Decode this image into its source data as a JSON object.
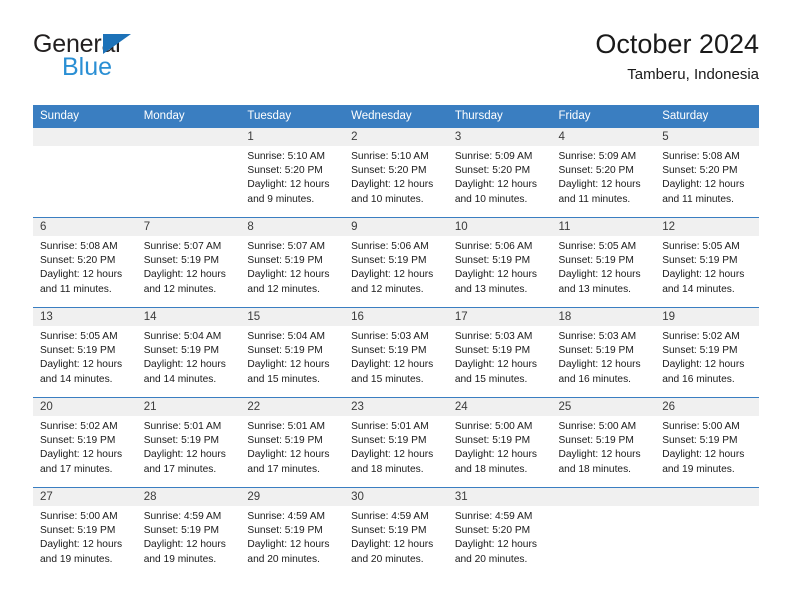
{
  "brand": {
    "name_part1": "General",
    "name_part2": "Blue",
    "triangle_color": "#1d72b8",
    "blue_text_color": "#2a8fd4"
  },
  "header": {
    "title": "October 2024",
    "location": "Tamberu, Indonesia"
  },
  "theme": {
    "header_blue": "#3a7ec1",
    "daynum_background": "#f0f0f0",
    "text_color": "#1a1a1a"
  },
  "weekdays": [
    "Sunday",
    "Monday",
    "Tuesday",
    "Wednesday",
    "Thursday",
    "Friday",
    "Saturday"
  ],
  "labels": {
    "sunrise_prefix": "Sunrise:",
    "sunset_prefix": "Sunset:",
    "daylight_prefix": "Daylight:"
  },
  "weeks": [
    [
      {
        "day": "",
        "sunrise": "",
        "sunset": "",
        "daylight_line1": "",
        "daylight_line2": ""
      },
      {
        "day": "",
        "sunrise": "",
        "sunset": "",
        "daylight_line1": "",
        "daylight_line2": ""
      },
      {
        "day": "1",
        "sunrise": "Sunrise: 5:10 AM",
        "sunset": "Sunset: 5:20 PM",
        "daylight_line1": "Daylight: 12 hours",
        "daylight_line2": "and 9 minutes."
      },
      {
        "day": "2",
        "sunrise": "Sunrise: 5:10 AM",
        "sunset": "Sunset: 5:20 PM",
        "daylight_line1": "Daylight: 12 hours",
        "daylight_line2": "and 10 minutes."
      },
      {
        "day": "3",
        "sunrise": "Sunrise: 5:09 AM",
        "sunset": "Sunset: 5:20 PM",
        "daylight_line1": "Daylight: 12 hours",
        "daylight_line2": "and 10 minutes."
      },
      {
        "day": "4",
        "sunrise": "Sunrise: 5:09 AM",
        "sunset": "Sunset: 5:20 PM",
        "daylight_line1": "Daylight: 12 hours",
        "daylight_line2": "and 11 minutes."
      },
      {
        "day": "5",
        "sunrise": "Sunrise: 5:08 AM",
        "sunset": "Sunset: 5:20 PM",
        "daylight_line1": "Daylight: 12 hours",
        "daylight_line2": "and 11 minutes."
      }
    ],
    [
      {
        "day": "6",
        "sunrise": "Sunrise: 5:08 AM",
        "sunset": "Sunset: 5:20 PM",
        "daylight_line1": "Daylight: 12 hours",
        "daylight_line2": "and 11 minutes."
      },
      {
        "day": "7",
        "sunrise": "Sunrise: 5:07 AM",
        "sunset": "Sunset: 5:19 PM",
        "daylight_line1": "Daylight: 12 hours",
        "daylight_line2": "and 12 minutes."
      },
      {
        "day": "8",
        "sunrise": "Sunrise: 5:07 AM",
        "sunset": "Sunset: 5:19 PM",
        "daylight_line1": "Daylight: 12 hours",
        "daylight_line2": "and 12 minutes."
      },
      {
        "day": "9",
        "sunrise": "Sunrise: 5:06 AM",
        "sunset": "Sunset: 5:19 PM",
        "daylight_line1": "Daylight: 12 hours",
        "daylight_line2": "and 12 minutes."
      },
      {
        "day": "10",
        "sunrise": "Sunrise: 5:06 AM",
        "sunset": "Sunset: 5:19 PM",
        "daylight_line1": "Daylight: 12 hours",
        "daylight_line2": "and 13 minutes."
      },
      {
        "day": "11",
        "sunrise": "Sunrise: 5:05 AM",
        "sunset": "Sunset: 5:19 PM",
        "daylight_line1": "Daylight: 12 hours",
        "daylight_line2": "and 13 minutes."
      },
      {
        "day": "12",
        "sunrise": "Sunrise: 5:05 AM",
        "sunset": "Sunset: 5:19 PM",
        "daylight_line1": "Daylight: 12 hours",
        "daylight_line2": "and 14 minutes."
      }
    ],
    [
      {
        "day": "13",
        "sunrise": "Sunrise: 5:05 AM",
        "sunset": "Sunset: 5:19 PM",
        "daylight_line1": "Daylight: 12 hours",
        "daylight_line2": "and 14 minutes."
      },
      {
        "day": "14",
        "sunrise": "Sunrise: 5:04 AM",
        "sunset": "Sunset: 5:19 PM",
        "daylight_line1": "Daylight: 12 hours",
        "daylight_line2": "and 14 minutes."
      },
      {
        "day": "15",
        "sunrise": "Sunrise: 5:04 AM",
        "sunset": "Sunset: 5:19 PM",
        "daylight_line1": "Daylight: 12 hours",
        "daylight_line2": "and 15 minutes."
      },
      {
        "day": "16",
        "sunrise": "Sunrise: 5:03 AM",
        "sunset": "Sunset: 5:19 PM",
        "daylight_line1": "Daylight: 12 hours",
        "daylight_line2": "and 15 minutes."
      },
      {
        "day": "17",
        "sunrise": "Sunrise: 5:03 AM",
        "sunset": "Sunset: 5:19 PM",
        "daylight_line1": "Daylight: 12 hours",
        "daylight_line2": "and 15 minutes."
      },
      {
        "day": "18",
        "sunrise": "Sunrise: 5:03 AM",
        "sunset": "Sunset: 5:19 PM",
        "daylight_line1": "Daylight: 12 hours",
        "daylight_line2": "and 16 minutes."
      },
      {
        "day": "19",
        "sunrise": "Sunrise: 5:02 AM",
        "sunset": "Sunset: 5:19 PM",
        "daylight_line1": "Daylight: 12 hours",
        "daylight_line2": "and 16 minutes."
      }
    ],
    [
      {
        "day": "20",
        "sunrise": "Sunrise: 5:02 AM",
        "sunset": "Sunset: 5:19 PM",
        "daylight_line1": "Daylight: 12 hours",
        "daylight_line2": "and 17 minutes."
      },
      {
        "day": "21",
        "sunrise": "Sunrise: 5:01 AM",
        "sunset": "Sunset: 5:19 PM",
        "daylight_line1": "Daylight: 12 hours",
        "daylight_line2": "and 17 minutes."
      },
      {
        "day": "22",
        "sunrise": "Sunrise: 5:01 AM",
        "sunset": "Sunset: 5:19 PM",
        "daylight_line1": "Daylight: 12 hours",
        "daylight_line2": "and 17 minutes."
      },
      {
        "day": "23",
        "sunrise": "Sunrise: 5:01 AM",
        "sunset": "Sunset: 5:19 PM",
        "daylight_line1": "Daylight: 12 hours",
        "daylight_line2": "and 18 minutes."
      },
      {
        "day": "24",
        "sunrise": "Sunrise: 5:00 AM",
        "sunset": "Sunset: 5:19 PM",
        "daylight_line1": "Daylight: 12 hours",
        "daylight_line2": "and 18 minutes."
      },
      {
        "day": "25",
        "sunrise": "Sunrise: 5:00 AM",
        "sunset": "Sunset: 5:19 PM",
        "daylight_line1": "Daylight: 12 hours",
        "daylight_line2": "and 18 minutes."
      },
      {
        "day": "26",
        "sunrise": "Sunrise: 5:00 AM",
        "sunset": "Sunset: 5:19 PM",
        "daylight_line1": "Daylight: 12 hours",
        "daylight_line2": "and 19 minutes."
      }
    ],
    [
      {
        "day": "27",
        "sunrise": "Sunrise: 5:00 AM",
        "sunset": "Sunset: 5:19 PM",
        "daylight_line1": "Daylight: 12 hours",
        "daylight_line2": "and 19 minutes."
      },
      {
        "day": "28",
        "sunrise": "Sunrise: 4:59 AM",
        "sunset": "Sunset: 5:19 PM",
        "daylight_line1": "Daylight: 12 hours",
        "daylight_line2": "and 19 minutes."
      },
      {
        "day": "29",
        "sunrise": "Sunrise: 4:59 AM",
        "sunset": "Sunset: 5:19 PM",
        "daylight_line1": "Daylight: 12 hours",
        "daylight_line2": "and 20 minutes."
      },
      {
        "day": "30",
        "sunrise": "Sunrise: 4:59 AM",
        "sunset": "Sunset: 5:19 PM",
        "daylight_line1": "Daylight: 12 hours",
        "daylight_line2": "and 20 minutes."
      },
      {
        "day": "31",
        "sunrise": "Sunrise: 4:59 AM",
        "sunset": "Sunset: 5:20 PM",
        "daylight_line1": "Daylight: 12 hours",
        "daylight_line2": "and 20 minutes."
      },
      {
        "day": "",
        "sunrise": "",
        "sunset": "",
        "daylight_line1": "",
        "daylight_line2": ""
      },
      {
        "day": "",
        "sunrise": "",
        "sunset": "",
        "daylight_line1": "",
        "daylight_line2": ""
      }
    ]
  ]
}
